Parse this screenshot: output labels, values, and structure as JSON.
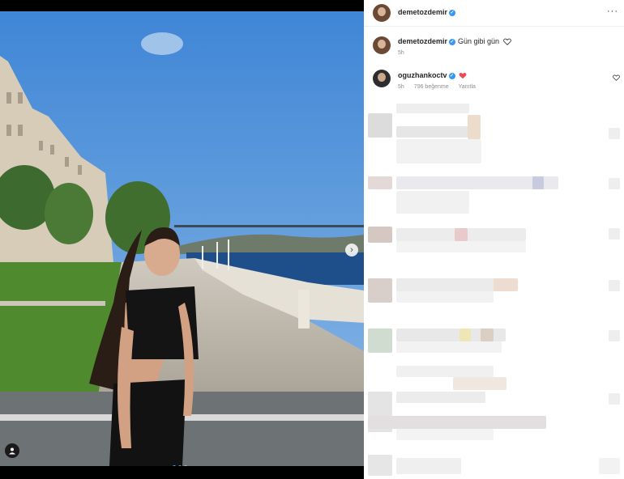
{
  "post": {
    "author": "demetozdemir",
    "caption_author": "demetozdemir",
    "caption_text": "Gün gibi gün",
    "caption_time": "5h"
  },
  "comment": {
    "author": "oguzhankoctv",
    "time": "5h",
    "likes": "796 beğenme",
    "reply": "Yanıtla"
  },
  "icons": {
    "verified": "verified-badge-icon",
    "more": "more-options-icon",
    "heart": "heart-icon",
    "next": "chevron-right-icon",
    "tag": "user-tag-icon"
  },
  "colors": {
    "verified": "#3897f0",
    "heart_red": "#ed4956",
    "meta_gray": "#8e8e8e"
  }
}
